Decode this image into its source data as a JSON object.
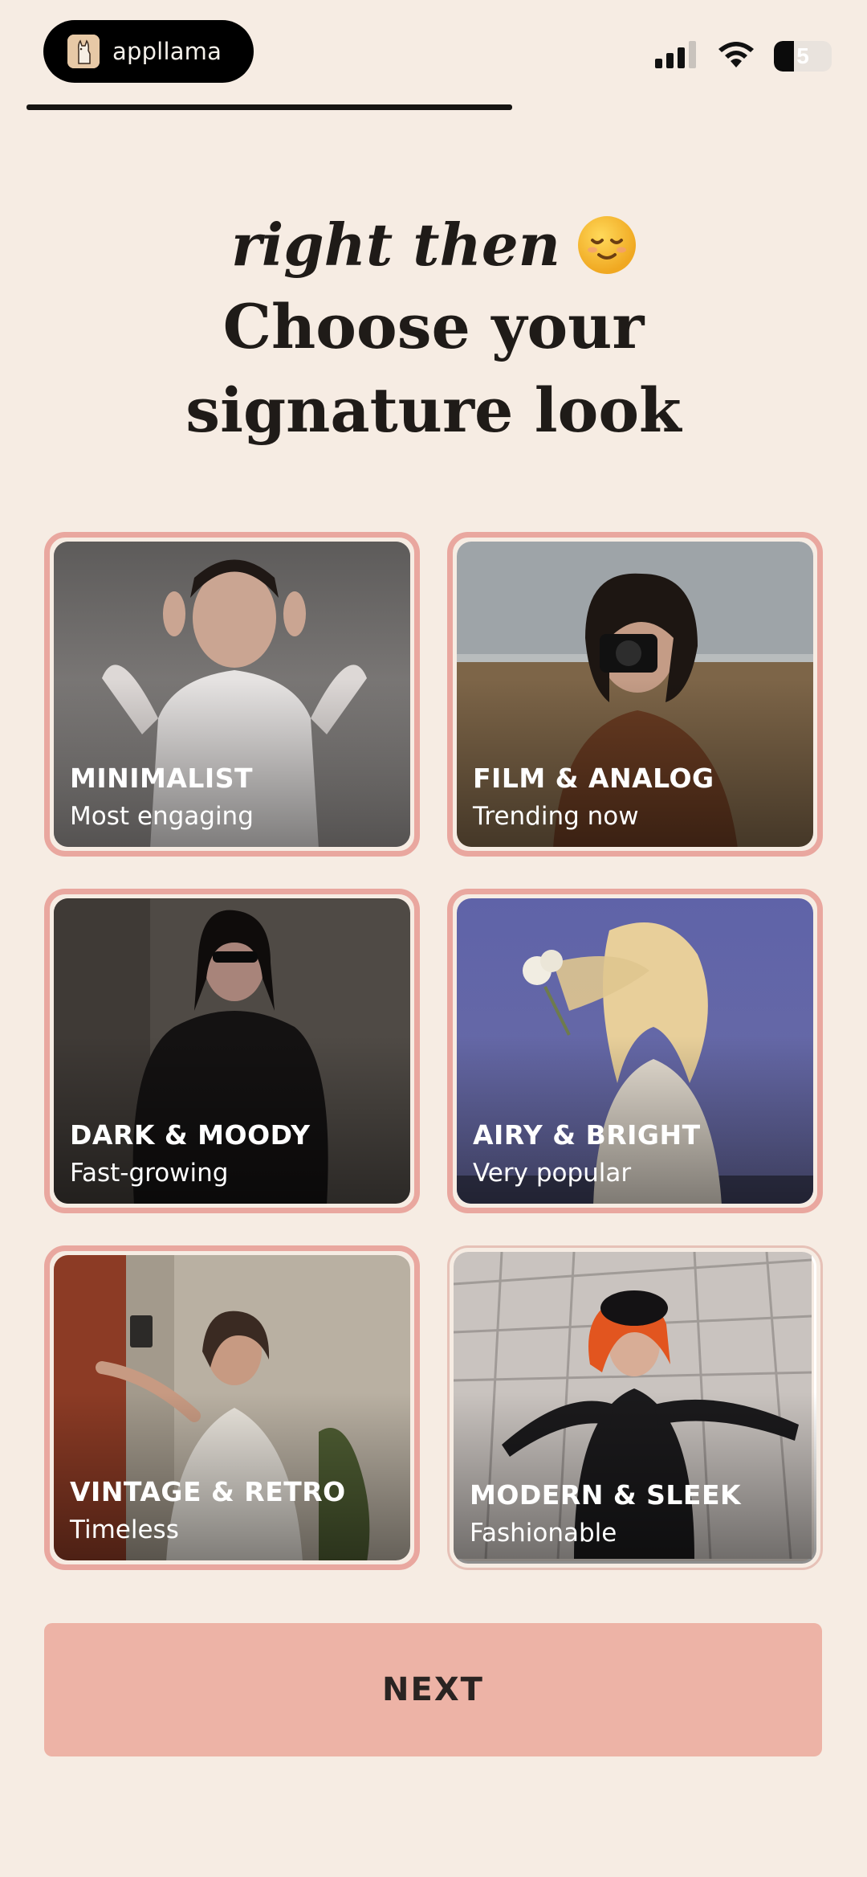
{
  "status_bar": {
    "app_name": "appllama",
    "battery_level": "5",
    "battery_fraction": 0.35
  },
  "onboarding": {
    "progress_fraction": 0.56
  },
  "heading": {
    "line1": "right then",
    "emoji": "relieved-face",
    "line2": "Choose your signature look"
  },
  "looks": [
    {
      "title": "MINIMALIST",
      "subtitle": "Most engaging",
      "selected": true
    },
    {
      "title": "FILM & ANALOG",
      "subtitle": "Trending now",
      "selected": true
    },
    {
      "title": "DARK & MOODY",
      "subtitle": "Fast-growing",
      "selected": true
    },
    {
      "title": "AIRY & BRIGHT",
      "subtitle": "Very popular",
      "selected": true
    },
    {
      "title": "VINTAGE & RETRO",
      "subtitle": "Timeless",
      "selected": true
    },
    {
      "title": "MODERN & SLEEK",
      "subtitle": "Fashionable",
      "selected": false
    }
  ],
  "next_button": {
    "label": "NEXT"
  },
  "colors": {
    "background": "#f6ece3",
    "accent": "#e9a79f",
    "button": "#edb3a6"
  }
}
